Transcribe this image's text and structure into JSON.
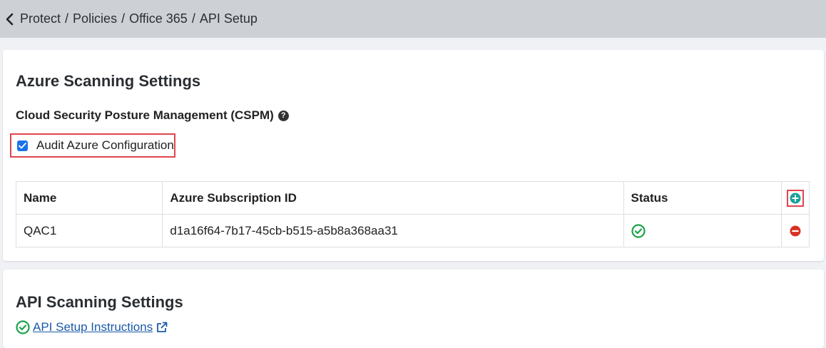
{
  "breadcrumb": {
    "items": [
      "Protect",
      "Policies",
      "Office 365",
      "API Setup"
    ],
    "separator": "/"
  },
  "azure_section": {
    "title": "Azure Scanning Settings",
    "cspm_heading": "Cloud Security Posture Management (CSPM)",
    "audit_checkbox": {
      "label": "Audit Azure Configuration",
      "checked": true
    },
    "table": {
      "headers": [
        "Name",
        "Azure Subscription ID",
        "Status"
      ],
      "rows": [
        {
          "name": "QAC1",
          "subscription_id": "d1a16f64-7b17-45cb-b515-a5b8a368aa31",
          "status": "ok"
        }
      ]
    }
  },
  "api_section": {
    "title": "API Scanning Settings",
    "setup_link": "API Setup Instructions"
  },
  "colors": {
    "topbar": "#cdd1d5",
    "accent_blue": "#1a73e8",
    "success_green": "#1aa34a",
    "danger_red": "#d93025",
    "teal": "#17a398",
    "highlight_red": "#e0454d"
  },
  "icons": {
    "back": "chevron-left-icon",
    "help": "question-circle-icon",
    "add": "plus-circle-icon",
    "status": "check-circle-icon",
    "remove": "minus-circle-icon",
    "link_status": "check-circle-icon",
    "external": "external-link-icon"
  }
}
